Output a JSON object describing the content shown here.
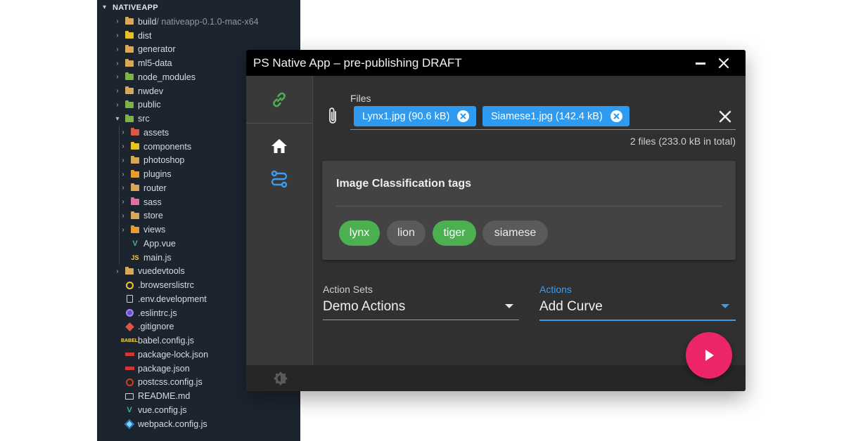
{
  "explorer": {
    "root_label": "NATIVEAPP",
    "items": [
      {
        "label": "build",
        "suffix": " / nativeapp-0.1.0-mac-x64"
      },
      {
        "label": "dist"
      },
      {
        "label": "generator"
      },
      {
        "label": "ml5-data"
      },
      {
        "label": "node_modules"
      },
      {
        "label": "nwdev"
      },
      {
        "label": "public"
      },
      {
        "label": "src"
      },
      {
        "label": "assets"
      },
      {
        "label": "components"
      },
      {
        "label": "photoshop"
      },
      {
        "label": "plugins"
      },
      {
        "label": "router"
      },
      {
        "label": "sass"
      },
      {
        "label": "store"
      },
      {
        "label": "views"
      },
      {
        "label": "App.vue"
      },
      {
        "label": "main.js"
      },
      {
        "label": "vuedevtools"
      },
      {
        "label": ".browserslistrc"
      },
      {
        "label": ".env.development"
      },
      {
        "label": ".eslintrc.js"
      },
      {
        "label": ".gitignore"
      },
      {
        "label": "babel.config.js"
      },
      {
        "label": "package-lock.json"
      },
      {
        "label": "package.json"
      },
      {
        "label": "postcss.config.js"
      },
      {
        "label": "README.md"
      },
      {
        "label": "vue.config.js"
      },
      {
        "label": "webpack.config.js"
      }
    ]
  },
  "window": {
    "title": "PS Native App – pre-publishing DRAFT"
  },
  "files": {
    "label": "Files",
    "chips": [
      {
        "label": "Lynx1.jpg (90.6 kB)"
      },
      {
        "label": "Siamese1.jpg (142.4 kB)"
      }
    ],
    "summary": "2 files (233.0 kB in total)"
  },
  "tags": {
    "title": "Image Classification tags",
    "items": [
      {
        "label": "lynx",
        "selected": true
      },
      {
        "label": "lion",
        "selected": false
      },
      {
        "label": "tiger",
        "selected": true
      },
      {
        "label": "siamese",
        "selected": false
      }
    ]
  },
  "action_sets": {
    "label": "Action Sets",
    "value": "Demo Actions"
  },
  "actions": {
    "label": "Actions",
    "value": "Add Curve"
  },
  "colors": {
    "accent_blue": "#2e9bf0",
    "tag_selected": "#4caf50",
    "fab": "#ec2666",
    "link_icon": "#4caf50"
  }
}
